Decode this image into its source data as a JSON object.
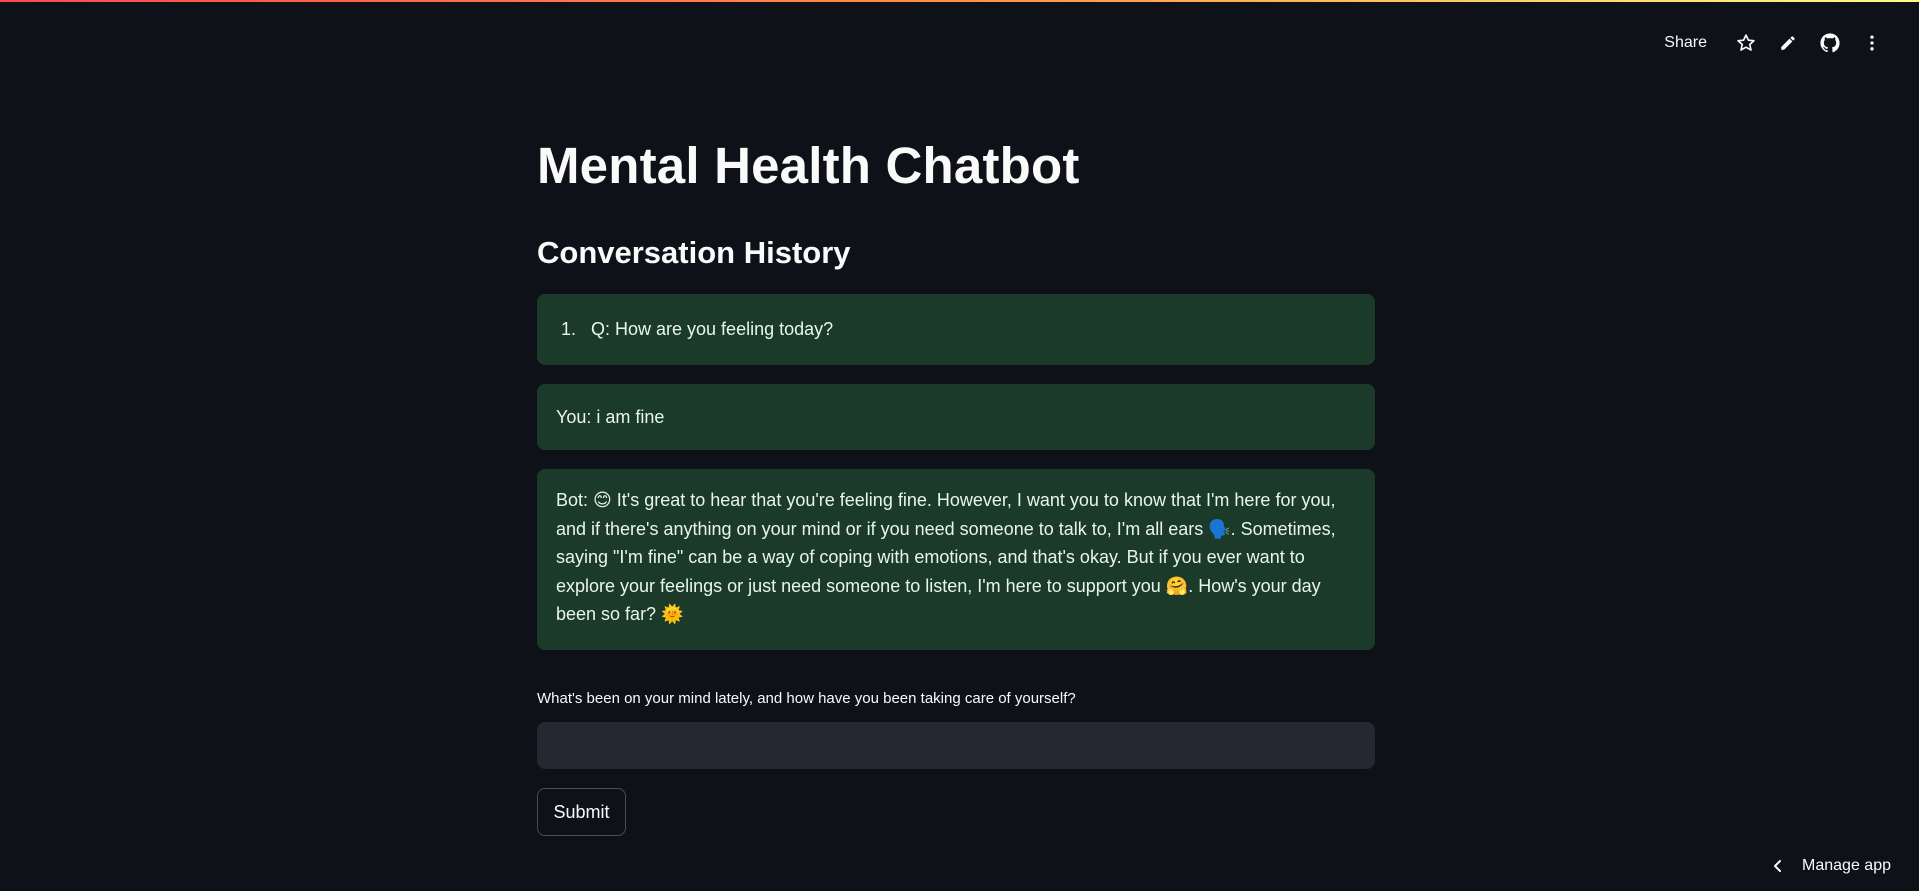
{
  "header": {
    "share_label": "Share",
    "icons": [
      "star-icon",
      "pencil-icon",
      "github-icon",
      "more-vertical-icon"
    ]
  },
  "main": {
    "title": "Mental Health Chatbot",
    "history_heading": "Conversation History",
    "question": {
      "number": "1.",
      "text": "Q: How are you feeling today?"
    },
    "user_message": "You: i am fine",
    "bot_message": "Bot: 😊 It's great to hear that you're feeling fine. However, I want you to know that I'm here for you, and if there's anything on your mind or if you need someone to talk to, I'm all ears 🗣️. Sometimes, saying \"I'm fine\" can be a way of coping with emotions, and that's okay. But if you ever want to explore your feelings or just need someone to listen, I'm here to support you 🤗. How's your day been so far? 🌞",
    "input_label": "What's been on your mind lately, and how have you been taking care of yourself?",
    "input_value": "",
    "submit_label": "Submit"
  },
  "footer": {
    "manage_app_label": "Manage app"
  },
  "colors": {
    "background": "#0e1117",
    "message_bg": "#1c3a2a",
    "input_bg": "#262730",
    "text": "#fafafa"
  }
}
